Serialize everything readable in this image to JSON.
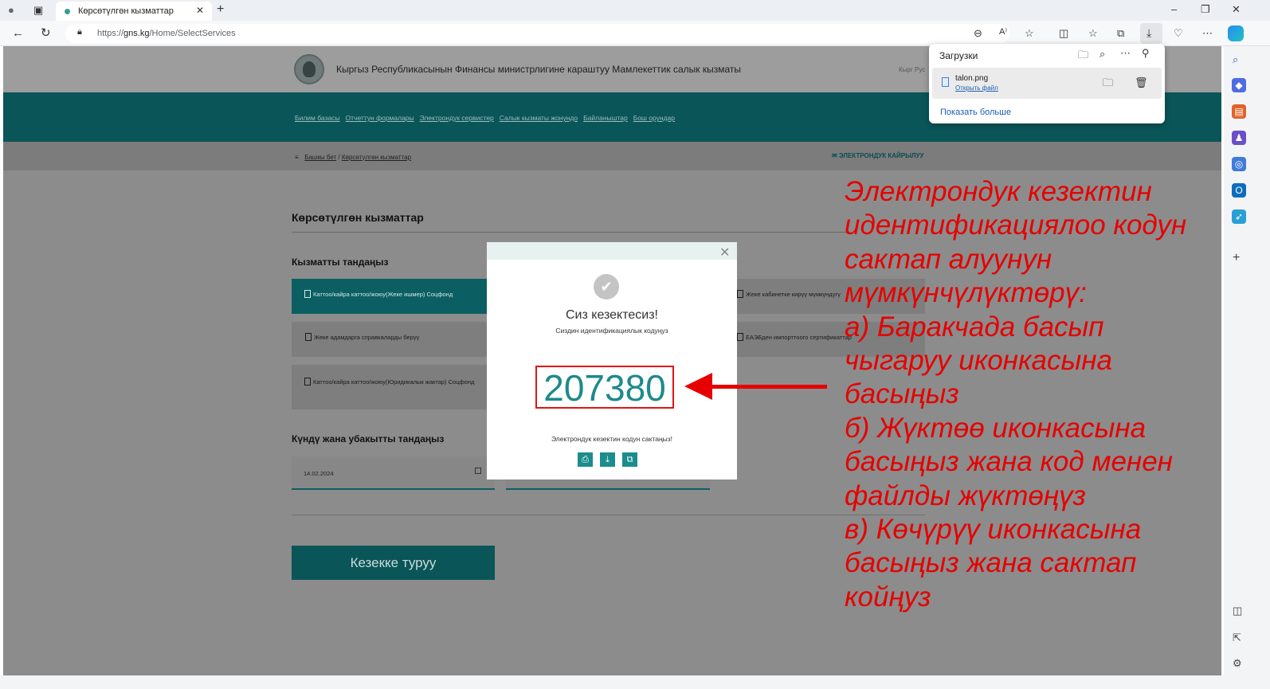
{
  "browser": {
    "tab_title": "Көрсөтүлгөн кызматтар",
    "url_prefix": "https://",
    "url_domain": "gns.kg",
    "url_path": "/Home/SelectServices",
    "downloads": {
      "title": "Загрузки",
      "file_name": "talon.png",
      "open_file": "Открыть файл",
      "show_more": "Показать больше"
    }
  },
  "site": {
    "ministry_title": "Кыргыз Республикасынын Финансы министрлигине караштуу Мамлекеттик салык кызматы",
    "languages": "Кырг  Рус",
    "nav": [
      "Билим базасы",
      "Отчеттун формалары",
      "Электрондук сервистер",
      "Салык кызматы жонундо",
      "Байланыштар",
      "Бош орундар"
    ],
    "breadcrumb": {
      "home": "Башкы бет",
      "separator": "/",
      "current": "Көрсөтүлгөн кызматтар"
    },
    "eservice_label": "ЭЛЕКТРОНДУК КАЙРЫЛУУ"
  },
  "form": {
    "heading": "Көрсөтүлгөн кызматтар",
    "choose_service": "Кызматты тандаңыз",
    "services": [
      {
        "label": "Каттоо/кайра каттоо/жоюу(Жеке ишмер) Соцфонд",
        "selected": true
      },
      {
        "label": "Жеке адамдарга справкаларды берүү",
        "selected": false
      },
      {
        "label": "Каттоо/кайра каттоо/жоюу(Юридикалык жактар) Соцфонд",
        "selected": false
      },
      {
        "label": "Жеке кабинетке кирүү мүмкүндүгү",
        "selected": false
      },
      {
        "label": "ЕАЭБден импорттоого сертификаттар",
        "selected": false
      }
    ],
    "choose_datetime": "Күндү жана убакытты тандаңыз",
    "date_value": "14.02.2024",
    "queue_button": "Кезекке туруу"
  },
  "modal": {
    "title": "Сиз кезектесиз!",
    "subtitle": "Сиздин идентификациялык кодуңуз",
    "code": "207380",
    "save_prompt": "Электрондук кезектин кодун сактаңыз!",
    "icons": [
      "printer-icon",
      "download-icon",
      "copy-icon"
    ]
  },
  "annotation": {
    "color": "#e60000",
    "lines": [
      "Электрондук кезектин",
      "идентификациялоо кодун",
      "сактап алуунун",
      "мүмкүнчүлүктөрү:",
      "а) Баракчада басып",
      "чыгаруу иконкасына",
      "басыңыз",
      "б) Жүктөө иконкасына",
      "басыңыз жана код менен",
      "файлды жүктөңүз",
      "в) Көчүрүү иконкасына",
      "басыңыз жана сактап",
      "койңуз"
    ]
  },
  "colors": {
    "teal_dark": "#0a5558",
    "teal_code": "#1d8a8a",
    "highlight_red": "#e01515"
  }
}
